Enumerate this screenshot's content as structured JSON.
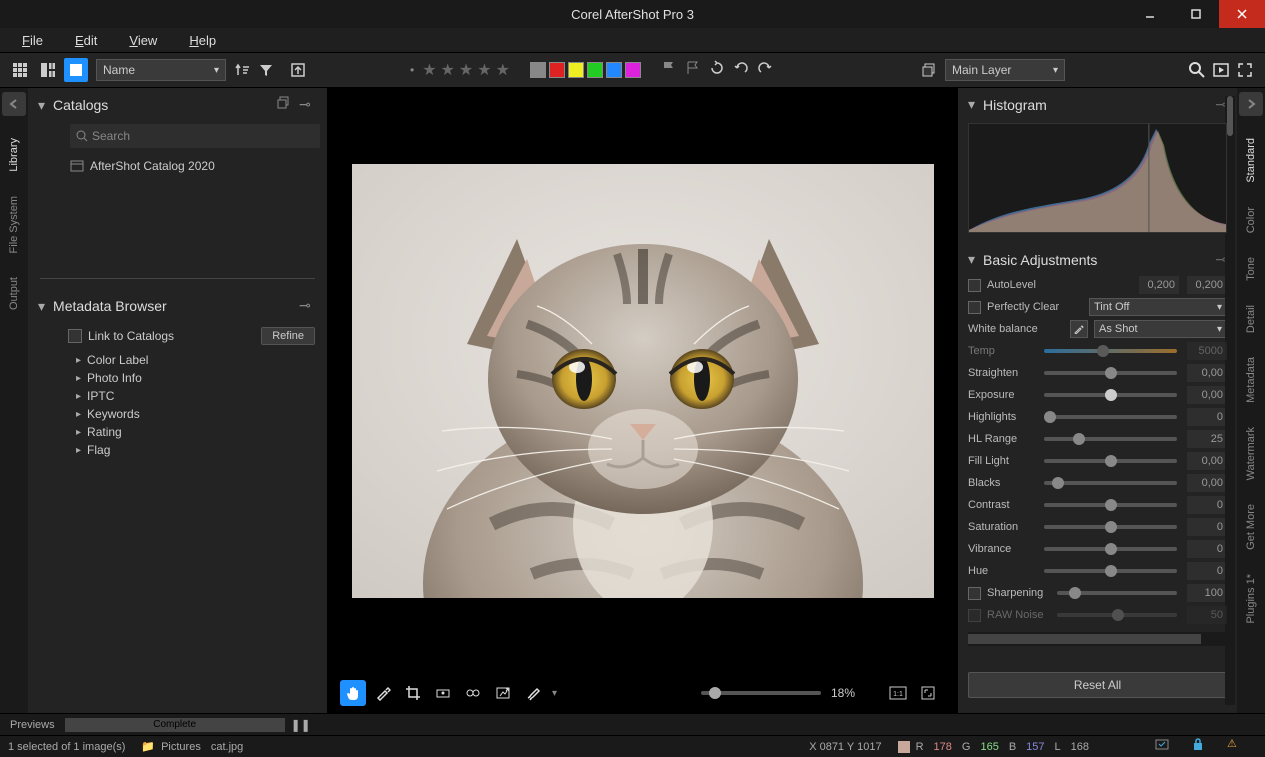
{
  "app": {
    "title": "Corel AfterShot Pro 3"
  },
  "menu": {
    "file": "File",
    "edit": "Edit",
    "view": "View",
    "help": "Help"
  },
  "toolbar": {
    "sort_field": "Name",
    "layer_select": "Main Layer",
    "swatches": [
      "#888888",
      "#d22",
      "#ee2",
      "#2c2",
      "#28f",
      "#d2d"
    ]
  },
  "left_tabs": {
    "library": "Library",
    "file_system": "File System",
    "output": "Output"
  },
  "catalogs": {
    "title": "Catalogs",
    "search_placeholder": "Search",
    "items": [
      "AfterShot Catalog 2020"
    ]
  },
  "metadata": {
    "title": "Metadata Browser",
    "link": "Link to Catalogs",
    "refine": "Refine",
    "items": [
      "Color Label",
      "Photo Info",
      "IPTC",
      "Keywords",
      "Rating",
      "Flag"
    ]
  },
  "viewer": {
    "zoom": "18%"
  },
  "right_tabs": {
    "standard": "Standard",
    "color": "Color",
    "tone": "Tone",
    "detail": "Detail",
    "metadata": "Metadata",
    "watermark": "Watermark",
    "getmore": "Get More",
    "plugins": "Plugins 1*"
  },
  "histogram": {
    "title": "Histogram"
  },
  "basic": {
    "title": "Basic Adjustments",
    "autolevel": {
      "label": "AutoLevel",
      "v1": "0,200",
      "v2": "0,200"
    },
    "pclear": {
      "label": "Perfectly Clear",
      "tint": "Tint Off"
    },
    "wb": {
      "label": "White balance",
      "mode": "As Shot"
    },
    "temp": {
      "label": "Temp",
      "val": "5000"
    },
    "straighten": {
      "label": "Straighten",
      "val": "0,00"
    },
    "exposure": {
      "label": "Exposure",
      "val": "0,00"
    },
    "highlights": {
      "label": "Highlights",
      "val": "0"
    },
    "hlrange": {
      "label": "HL Range",
      "val": "25"
    },
    "fill": {
      "label": "Fill Light",
      "val": "0,00"
    },
    "blacks": {
      "label": "Blacks",
      "val": "0,00"
    },
    "contrast": {
      "label": "Contrast",
      "val": "0"
    },
    "saturation": {
      "label": "Saturation",
      "val": "0"
    },
    "vibrance": {
      "label": "Vibrance",
      "val": "0"
    },
    "hue": {
      "label": "Hue",
      "val": "0"
    },
    "sharpening": {
      "label": "Sharpening",
      "val": "100"
    },
    "rawnoise": {
      "label": "RAW Noise",
      "val": "50"
    },
    "reset": "Reset All"
  },
  "preview": {
    "label": "Previews",
    "status": "Complete"
  },
  "status": {
    "selection": "1 selected of 1 image(s)",
    "folder": "Pictures",
    "file": "cat.jpg",
    "pos": "X 0871  Y 1017",
    "r": "R",
    "rv": "178",
    "g": "G",
    "gv": "165",
    "b": "B",
    "bv": "157",
    "l": "L",
    "lv": "168"
  }
}
